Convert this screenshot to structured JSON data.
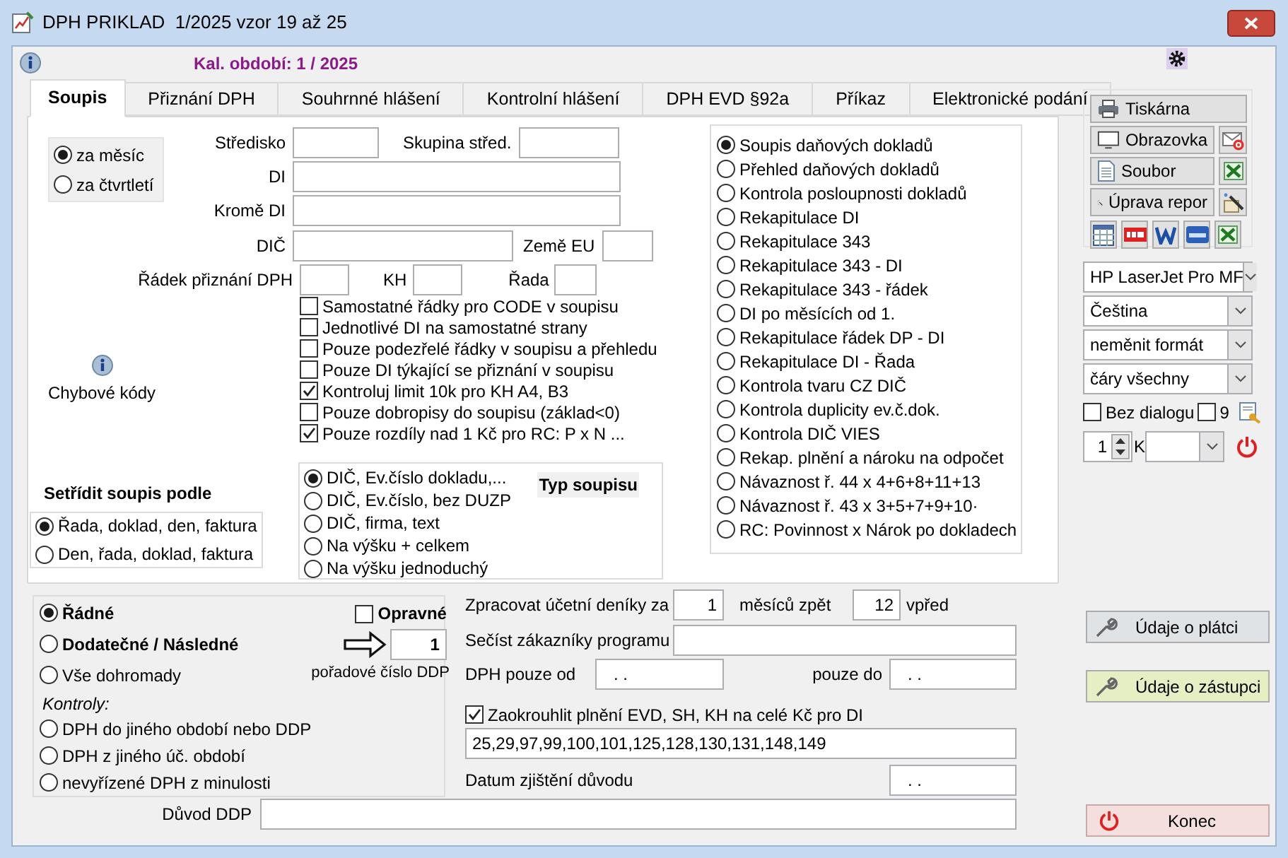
{
  "window": {
    "title": "DPH PRIKLAD  1/2025 vzor 19 až 25"
  },
  "period_label": "Kal. období: 1 / 2025",
  "tabs": [
    {
      "label": "Soupis",
      "selected": true
    },
    {
      "label": "Přiznání DPH",
      "selected": false
    },
    {
      "label": "Souhrnné hlášení",
      "selected": false
    },
    {
      "label": "Kontrolní hlášení",
      "selected": false
    },
    {
      "label": "DPH EVD §92a",
      "selected": false
    },
    {
      "label": "Příkaz",
      "selected": false
    },
    {
      "label": "Elektronické podání",
      "selected": false
    }
  ],
  "period_type": [
    {
      "label": "za měsíc",
      "selected": true
    },
    {
      "label": "za čtvrtletí",
      "selected": false
    }
  ],
  "fields": {
    "stredisko": {
      "label": "Středisko"
    },
    "skupina": {
      "label": "Skupina střed."
    },
    "di": {
      "label": "DI"
    },
    "krome_di": {
      "label": "Kromě DI"
    },
    "dic": {
      "label": "DIČ"
    },
    "zeme_eu": {
      "label": "Země EU"
    },
    "radek": {
      "label": "Řádek přiznání DPH"
    },
    "kh": {
      "label": "KH"
    },
    "rada": {
      "label": "Řada"
    }
  },
  "options": [
    {
      "label": "Samostatné řádky pro CODE v soupisu",
      "checked": false
    },
    {
      "label": "Jednotlivé DI na samostatné strany",
      "checked": false
    },
    {
      "label": "Pouze podezřelé řádky v soupisu a přehledu",
      "checked": false
    },
    {
      "label": "Pouze DI týkající se přiznání v soupisu",
      "checked": false
    },
    {
      "label": "Kontroluj limit 10k pro KH A4, B3",
      "checked": true
    },
    {
      "label": "Pouze dobropisy do soupisu (základ<0)",
      "checked": false
    },
    {
      "label": "Pouze rozdíly nad 1 Kč pro RC: P x N ...",
      "checked": true
    }
  ],
  "error_codes": "Chybové kódy",
  "sort": {
    "title": "Setřídit soupis podle",
    "options": [
      {
        "label": "Řada, doklad, den, faktura",
        "selected": true
      },
      {
        "label": "Den, řada, doklad, faktura",
        "selected": false
      }
    ]
  },
  "list_type": {
    "title": "Typ soupisu",
    "options": [
      {
        "label": "DIČ, Ev.číslo dokladu,...",
        "selected": true
      },
      {
        "label": "DIČ, Ev.číslo, bez DUZP",
        "selected": false
      },
      {
        "label": "DIČ, firma, text",
        "selected": false
      },
      {
        "label": "Na výšku + celkem",
        "selected": false
      },
      {
        "label": "Na výšku jednoduchý",
        "selected": false
      }
    ]
  },
  "reports": [
    {
      "label": "Soupis daňových dokladů",
      "selected": true
    },
    {
      "label": "Přehled daňových dokladů",
      "selected": false
    },
    {
      "label": "Kontrola posloupnosti dokladů",
      "selected": false
    },
    {
      "label": "Rekapitulace DI",
      "selected": false
    },
    {
      "label": "Rekapitulace 343",
      "selected": false
    },
    {
      "label": "Rekapitulace 343 - DI",
      "selected": false
    },
    {
      "label": "Rekapitulace 343 - řádek",
      "selected": false
    },
    {
      "label": "DI po měsících od 1.",
      "selected": false
    },
    {
      "label": "Rekapitulace řádek DP - DI",
      "selected": false
    },
    {
      "label": "Rekapitulace DI - Řada",
      "selected": false
    },
    {
      "label": "Kontrola tvaru CZ DIČ",
      "selected": false
    },
    {
      "label": "Kontrola duplicity ev.č.dok.",
      "selected": false
    },
    {
      "label": "Kontrola DIČ VIES",
      "selected": false
    },
    {
      "label": "Rekap. plnění a nároku na odpočet",
      "selected": false
    },
    {
      "label": "Návaznost ř. 44 x 4+6+8+11+13",
      "selected": false
    },
    {
      "label": "Návaznost ř. 43 x 3+5+7+9+10·",
      "selected": false
    },
    {
      "label": "RC: Povinnost x Nárok po dokladech",
      "selected": false
    }
  ],
  "output_buttons": {
    "printer": "Tiskárna",
    "screen": "Obrazovka",
    "file": "Soubor",
    "report_edit": "Úprava repor"
  },
  "selects": [
    "HP LaserJet Pro MF",
    "Čeština",
    "neměnit formát",
    "čáry všechny"
  ],
  "no_dialog": {
    "label": "Bez dialogu",
    "checked": false
  },
  "option_9": {
    "label": "9",
    "checked": false
  },
  "copies": "1",
  "k_label": "K",
  "submission": [
    {
      "label": "Řádné",
      "selected": true,
      "bold": true
    },
    {
      "label": "Dodatečné / Následné",
      "selected": false,
      "bold": true
    },
    {
      "label": "Vše dohromady",
      "selected": false,
      "bold": false
    }
  ],
  "corrective": {
    "label": "Opravné",
    "checked": false
  },
  "ddp_number": {
    "value": "1",
    "caption": "pořadové číslo DDP"
  },
  "checks_title": "Kontroly:",
  "checks": [
    {
      "label": "DPH do jiného období nebo DDP",
      "selected": false
    },
    {
      "label": "DPH z jiného úč. období",
      "selected": false
    },
    {
      "label": "nevyřízené DPH z minulosti",
      "selected": false
    }
  ],
  "journals": {
    "label": "Zpracovat účetní deníky za",
    "back": "1",
    "back_label": "měsíců zpět",
    "forward": "12",
    "forward_label": "vpřed"
  },
  "sum_customers": {
    "label": "Sečíst zákazníky programu"
  },
  "vat_from": {
    "label": "DPH pouze od",
    "value": ". ."
  },
  "vat_to": {
    "label": "pouze do",
    "value": ". ."
  },
  "rounding": {
    "label": "Zaokrouhlit plnění EVD, SH, KH na celé Kč pro DI",
    "checked": true,
    "value": "25,29,97,99,100,101,125,128,130,131,148,149"
  },
  "discovery_date": {
    "label": "Datum zjištění důvodu",
    "value": ". ."
  },
  "reason": {
    "label": "Důvod DDP"
  },
  "side_buttons": [
    {
      "label": "Údaje o plátci",
      "kind": "plain"
    },
    {
      "label": "Údaje o zástupci",
      "kind": "highlight"
    }
  ],
  "exit_button": "Konec"
}
